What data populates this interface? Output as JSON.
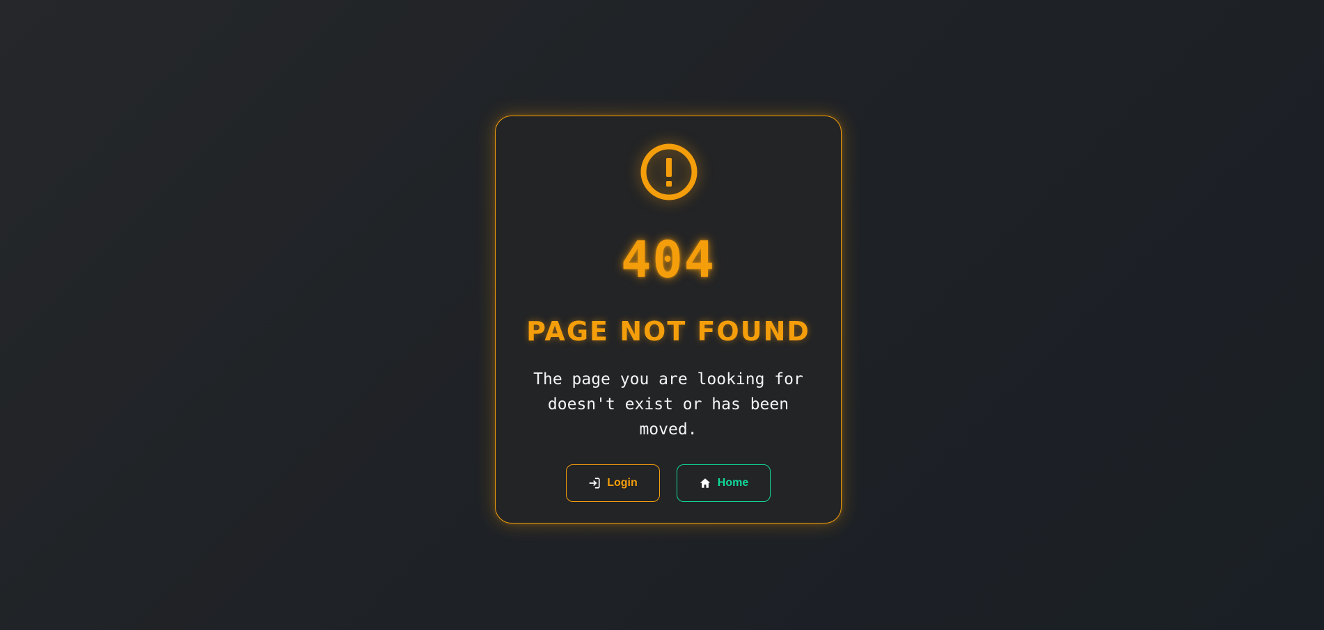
{
  "error": {
    "icon": "alert-circle-icon",
    "code": "404",
    "title": "PAGE NOT FOUND",
    "message": "The page you are looking for doesn't exist or has been moved."
  },
  "actions": {
    "login": {
      "label": "Login",
      "icon": "login-icon"
    },
    "home": {
      "label": "Home",
      "icon": "home-icon"
    }
  },
  "colors": {
    "accent": "#f59e0b",
    "secondary": "#10d99a",
    "background": "#1f2226",
    "card": "#232426",
    "text": "#f4f4f5"
  }
}
